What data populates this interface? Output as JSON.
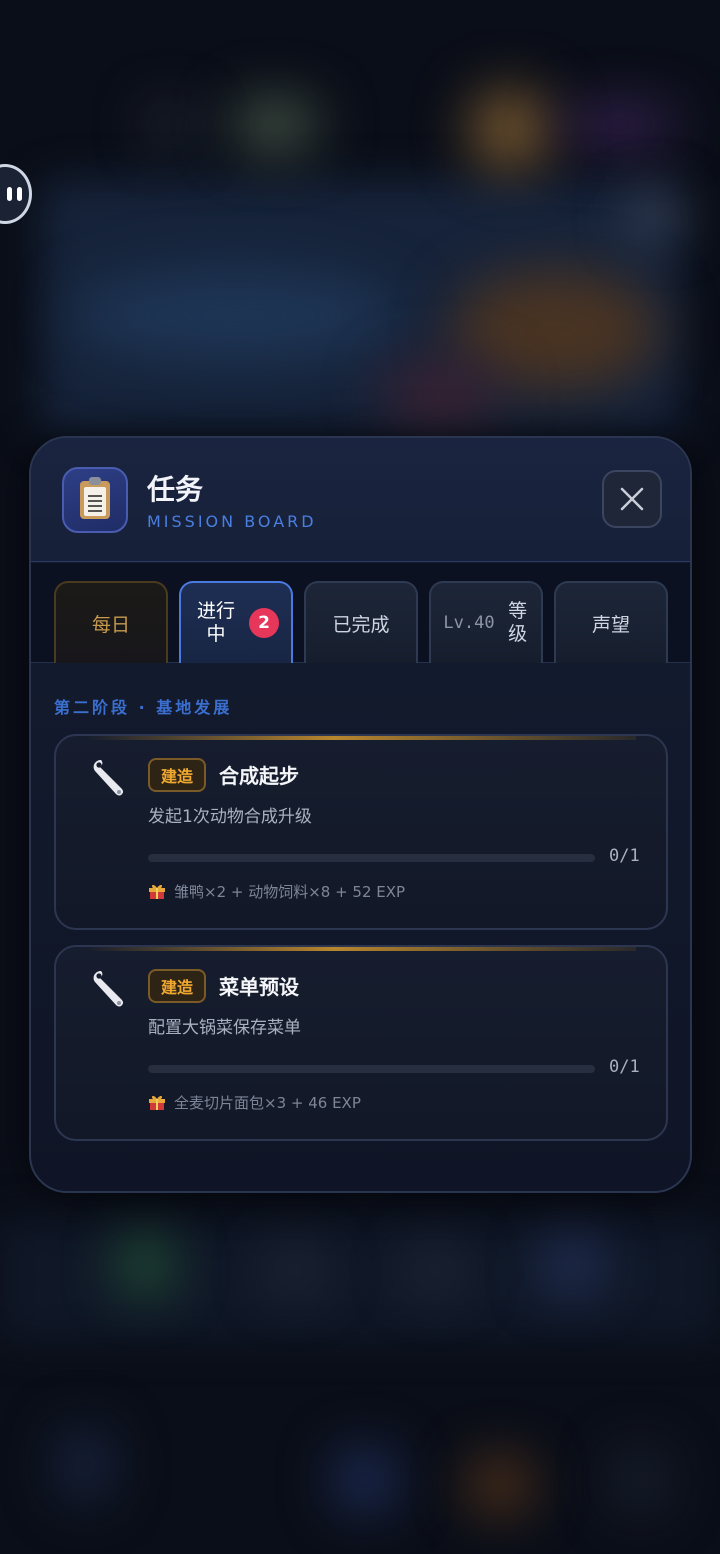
{
  "modal": {
    "title": "任务",
    "subtitle": "MISSION BOARD",
    "header_icon": "clipboard-icon",
    "close_icon": "close-icon"
  },
  "tabs": [
    {
      "label": "每日",
      "state": "default"
    },
    {
      "label": "进行中",
      "label_line1": "进行",
      "label_line2": "中",
      "badge": "2",
      "state": "active"
    },
    {
      "label": "已完成",
      "state": "default"
    },
    {
      "level": "Lv.40",
      "label_line1": "等",
      "label_line2": "级",
      "state": "default"
    },
    {
      "label": "声望",
      "state": "default"
    }
  ],
  "stage": {
    "title": "第二阶段 · 基地发展"
  },
  "missions": [
    {
      "icon": "wrench-icon",
      "tag": "建造",
      "title": "合成起步",
      "description": "发起1次动物合成升级",
      "progress_text": "0/1",
      "progress_value": 0,
      "reward_icon": "gift-icon",
      "reward": "雏鸭×2 + 动物饲料×8 + 52 EXP"
    },
    {
      "icon": "wrench-icon",
      "tag": "建造",
      "title": "菜单预设",
      "description": "配置大锅菜保存菜单",
      "progress_text": "0/1",
      "progress_value": 0,
      "reward_icon": "gift-icon",
      "reward": "全麦切片面包×3 + 46 EXP"
    }
  ],
  "colors": {
    "accent_blue": "#4a7fe0",
    "badge_red": "#e6365a",
    "tag_gold": "#f0a830",
    "daily_gold": "#c79a4e"
  }
}
